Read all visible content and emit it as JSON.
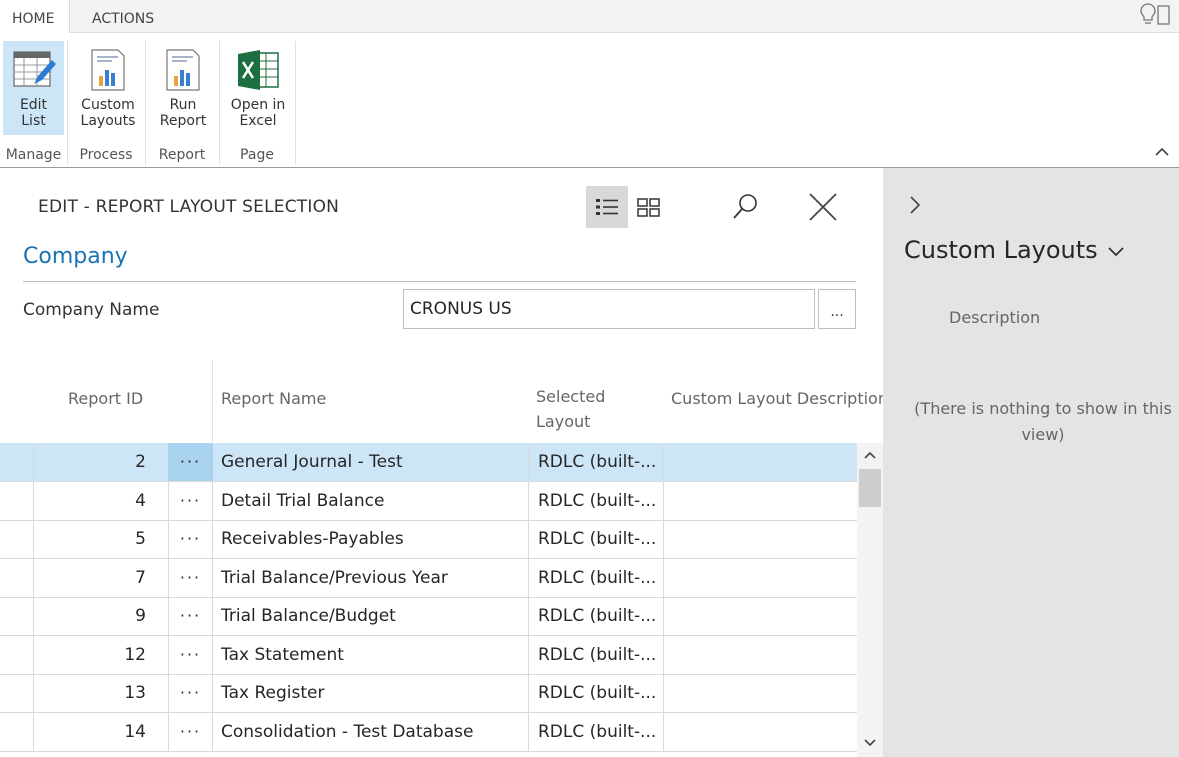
{
  "ribbon": {
    "tabs": [
      {
        "label": "HOME",
        "active": true
      },
      {
        "label": "ACTIONS",
        "active": false
      }
    ],
    "buttons": {
      "edit_list": {
        "line1": "Edit",
        "line2": "List"
      },
      "custom_layouts": {
        "line1": "Custom",
        "line2": "Layouts"
      },
      "run_report": {
        "line1": "Run",
        "line2": "Report"
      },
      "open_excel": {
        "line1": "Open in",
        "line2": "Excel"
      }
    },
    "groups": {
      "manage": "Manage",
      "process": "Process",
      "report": "Report",
      "page": "Page"
    }
  },
  "page": {
    "title": "EDIT - REPORT LAYOUT SELECTION",
    "fasttab": "Company",
    "company_name_label": "Company Name",
    "company_name_value": "CRONUS US",
    "lookup_label": "..."
  },
  "grid": {
    "headers": {
      "report_id": "Report ID",
      "report_name": "Report Name",
      "selected_layout_1": "Selected",
      "selected_layout_2": "Layout",
      "custom_layout_description": "Custom Layout Description"
    },
    "row_menu_glyph": "···",
    "rows": [
      {
        "id": "2",
        "name": "General Journal - Test",
        "layout": "RDLC (built-..."
      },
      {
        "id": "4",
        "name": "Detail Trial Balance",
        "layout": "RDLC (built-..."
      },
      {
        "id": "5",
        "name": "Receivables-Payables",
        "layout": "RDLC (built-..."
      },
      {
        "id": "7",
        "name": "Trial Balance/Previous Year",
        "layout": "RDLC (built-..."
      },
      {
        "id": "9",
        "name": "Trial Balance/Budget",
        "layout": "RDLC (built-..."
      },
      {
        "id": "12",
        "name": "Tax Statement",
        "layout": "RDLC (built-..."
      },
      {
        "id": "13",
        "name": "Tax Register",
        "layout": "RDLC (built-..."
      },
      {
        "id": "14",
        "name": "Consolidation - Test Database",
        "layout": "RDLC (built-..."
      }
    ]
  },
  "factbox": {
    "title": "Custom Layouts",
    "column_header": "Description",
    "empty_line1": "(There is nothing to show in this",
    "empty_line2": "view)"
  },
  "colors": {
    "accent": "#1a73b5",
    "selection": "#cde6f7",
    "factbox_bg": "#e4e4e4",
    "excel_green": "#1d6f42"
  }
}
